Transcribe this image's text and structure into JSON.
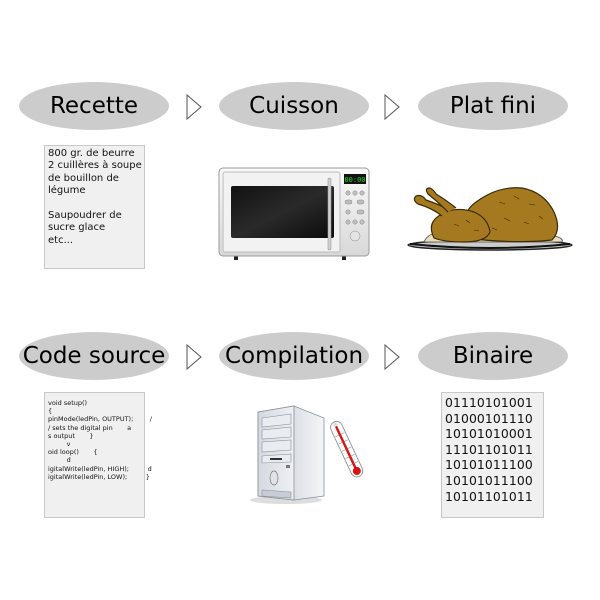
{
  "rows": [
    {
      "steps": [
        {
          "label": "Recette",
          "visual": "recipe-card"
        },
        {
          "label": "Cuisson",
          "visual": "microwave-icon"
        },
        {
          "label": "Plat fini",
          "visual": "roast-chicken-icon"
        }
      ]
    },
    {
      "steps": [
        {
          "label": "Code source",
          "visual": "source-code-card"
        },
        {
          "label": "Compilation",
          "visual": "computer-thermometer-icon"
        },
        {
          "label": "Binaire",
          "visual": "binary-card"
        }
      ]
    }
  ],
  "recipe": {
    "lines": [
      "800 gr. de beurre",
      "2 cuillères à soupe",
      "de bouillon de",
      "légume",
      "",
      "Saupoudrer de",
      "sucre glace",
      "etc..."
    ]
  },
  "code": {
    "lines": [
      "void setup()",
      "{",
      "pinMode(ledPin, OUTPUT);        /",
      "/ sets the digital pin       a",
      "s output       }",
      "         v",
      "oid loop()       {",
      "         d",
      "igitalWrite(ledPin, HIGH);         d",
      "igitalWrite(ledPin, LOW);         }"
    ]
  },
  "binary": {
    "lines": [
      "01110101001",
      "01000101110",
      "10101010001",
      "11101101011",
      "10101011100",
      "10101011100",
      "10101101011"
    ]
  },
  "microwave": {
    "display": "00:00"
  },
  "colors": {
    "ellipse": "#cccccc",
    "card_bg": "#f0f0f0",
    "display_green": "#22dd22",
    "thermometer_red": "#dd1111"
  }
}
